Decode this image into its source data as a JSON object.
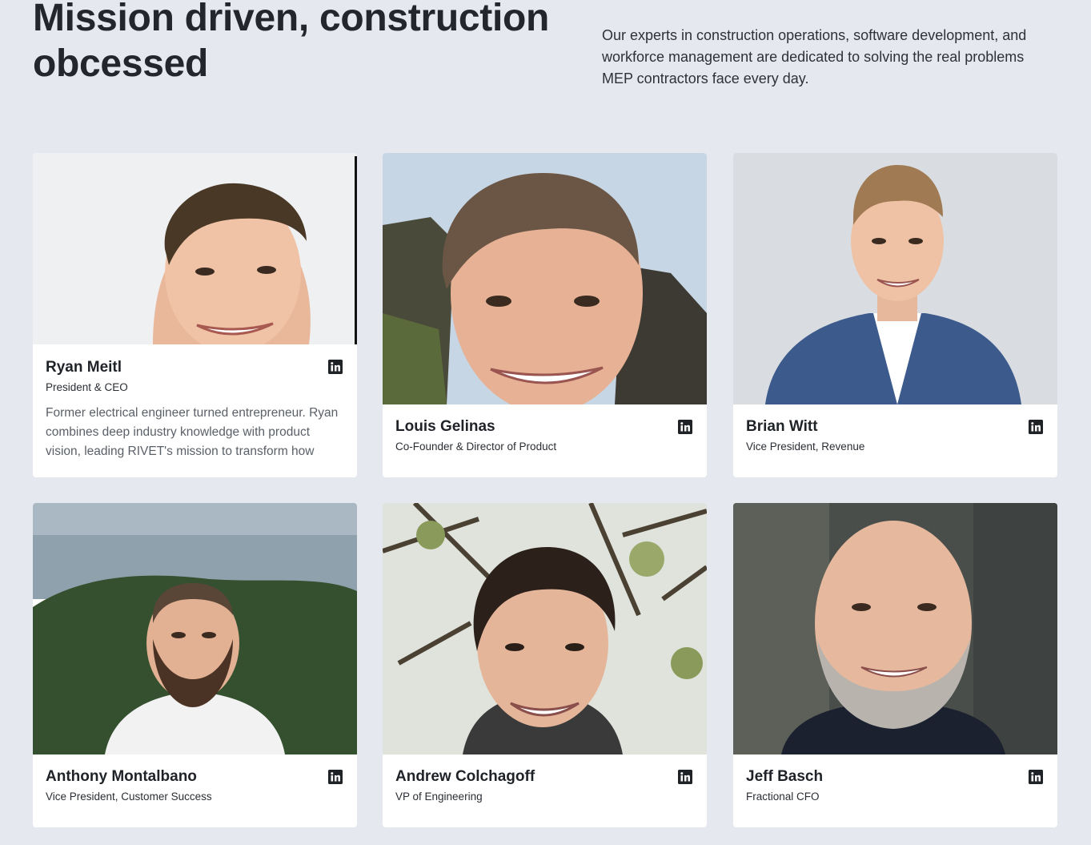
{
  "hero": {
    "title_line1": "Mission driven, construction",
    "title_line2": "obcessed",
    "description": "Our experts in construction operations, software development, and workforce management are dedicated to solving the real problems MEP contractors face every day."
  },
  "team": [
    {
      "name": "Ryan Meitl",
      "role": "President & CEO",
      "bio": "Former electrical engineer turned entrepreneur. Ryan combines deep industry knowledge with product vision, leading RIVET's mission to transform how",
      "icon": "linkedin-icon"
    },
    {
      "name": "Louis Gelinas",
      "role": "Co-Founder & Director of Product",
      "icon": "linkedin-icon"
    },
    {
      "name": "Brian Witt",
      "role": "Vice President, Revenue",
      "icon": "linkedin-icon"
    },
    {
      "name": "Anthony Montalbano",
      "role": "Vice President, Customer Success",
      "icon": "linkedin-icon"
    },
    {
      "name": "Andrew Colchagoff",
      "role": "VP of Engineering",
      "icon": "linkedin-icon"
    },
    {
      "name": "Jeff Basch",
      "role": "Fractional CFO",
      "icon": "linkedin-icon"
    }
  ],
  "colors": {
    "page_background": "#e5e8ef",
    "card_background": "#ffffff",
    "text_primary": "#1f2328",
    "text_muted": "#5b6068"
  }
}
